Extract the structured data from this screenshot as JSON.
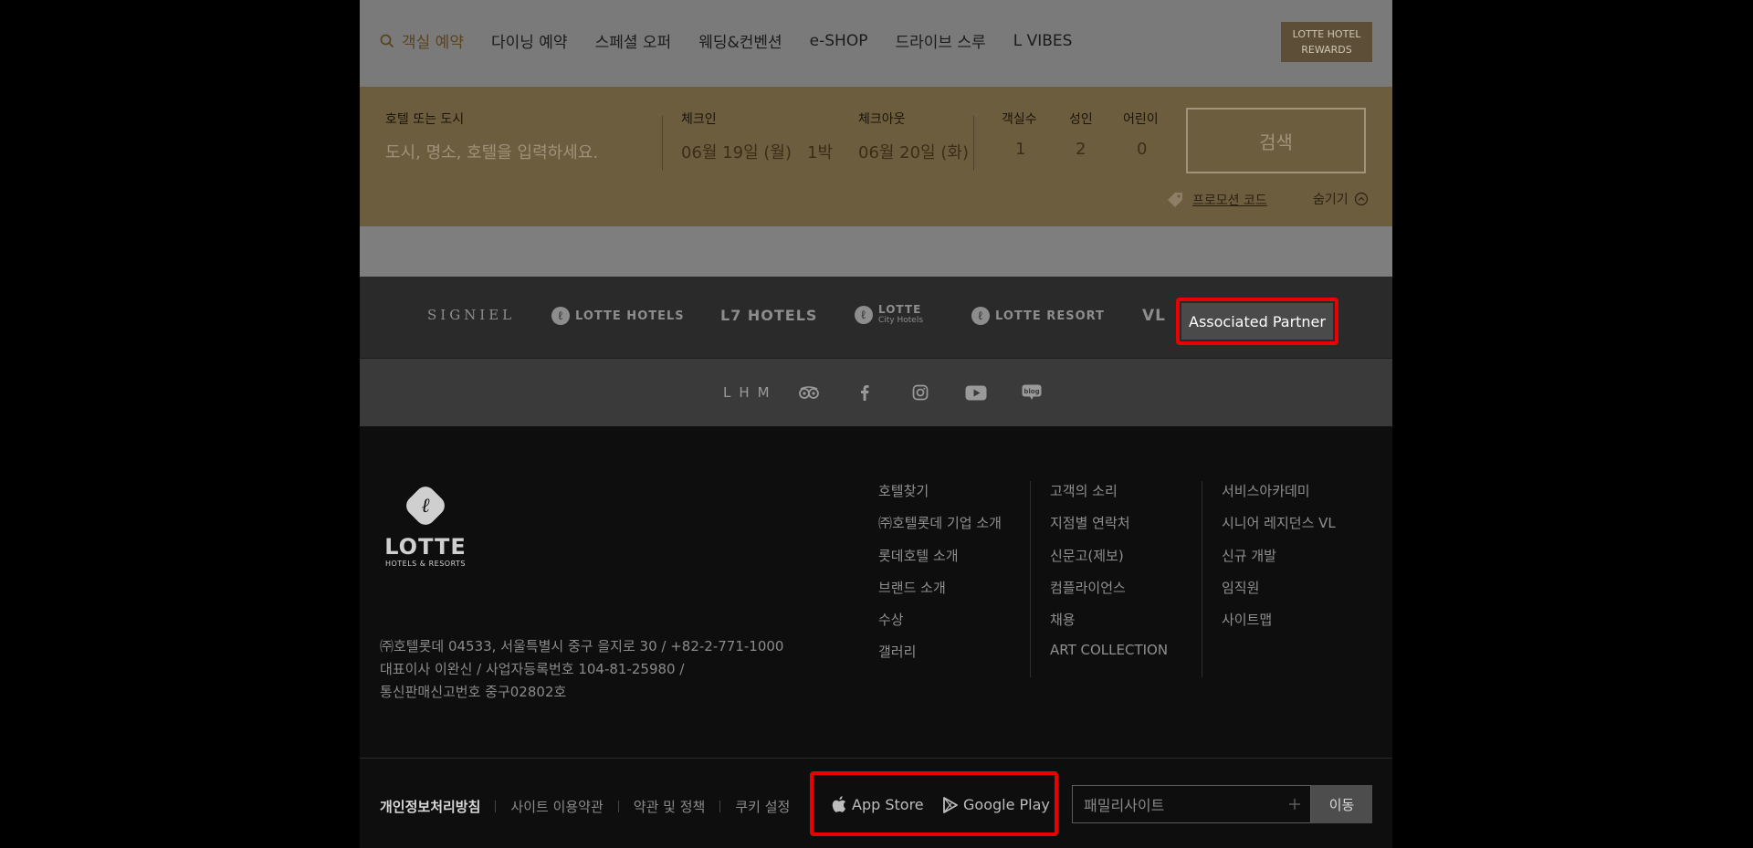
{
  "nav": {
    "items": [
      "객실 예약",
      "다이닝 예약",
      "스페셜 오퍼",
      "웨딩&컨벤션",
      "e-SHOP",
      "드라이브 스루",
      "L VIBES"
    ],
    "rewards_line1": "LOTTE HOTEL",
    "rewards_line2": "REWARDS"
  },
  "booking": {
    "destination_label": "호텔 또는 도시",
    "destination_placeholder": "도시, 명소, 호텔을 입력하세요.",
    "checkin_label": "체크인",
    "checkin_value": "06월 19일 (월)",
    "nights": "1박",
    "checkout_label": "체크아웃",
    "checkout_value": "06월 20일 (화)",
    "rooms_label": "객실수",
    "rooms_value": "1",
    "adults_label": "성인",
    "adults_value": "2",
    "children_label": "어린이",
    "children_value": "0",
    "search_label": "검색",
    "promo_label": "프로모션 코드",
    "hide_label": "숨기기"
  },
  "brands": {
    "items": [
      "SIGNIEL",
      "LOTTE HOTELS",
      "L7 HOTELS",
      "LOTTE City Hotels",
      "LOTTE RESORT",
      "VL"
    ],
    "city_line1": "LOTTE",
    "city_line2": "City Hotels",
    "associated_partner": "Associated Partner"
  },
  "social": {
    "lhm": "LHM",
    "icons": [
      "tripadvisor-icon",
      "facebook-icon",
      "instagram-icon",
      "youtube-icon",
      "blog-icon"
    ]
  },
  "footer": {
    "logo_name": "LOTTE",
    "logo_sub": "HOTELS & RESORTS",
    "address_line1": "㈜호텔롯데     04533, 서울특별시 중구 을지로 30 / +82-2-771-1000",
    "address_line2": "대표이사 이완신 / 사업자등록번호 104-81-25980 /",
    "address_line3": "통신판매신고번호 중구02802호",
    "col1": [
      "호텔찾기",
      "㈜호텔롯데 기업 소개",
      "롯데호텔 소개",
      "브랜드 소개",
      "수상",
      "갤러리"
    ],
    "col2": [
      "고객의 소리",
      "지점별 연락처",
      "신문고(제보)",
      "컴플라이언스",
      "채용",
      "ART COLLECTION"
    ],
    "col3": [
      "서비스아카데미",
      "시니어 레지던스 VL",
      "신규 개발",
      "임직원",
      "사이트맵"
    ],
    "legal": [
      "개인정보처리방침",
      "사이트 이용약관",
      "약관 및 정책",
      "쿠키 설정"
    ],
    "app_store": "App Store",
    "google_play": "Google Play",
    "family_site": "패밀리사이트",
    "go": "이동"
  },
  "colors": {
    "booking_bg": "#6d5d3f",
    "highlight_border": "#ea0000"
  }
}
